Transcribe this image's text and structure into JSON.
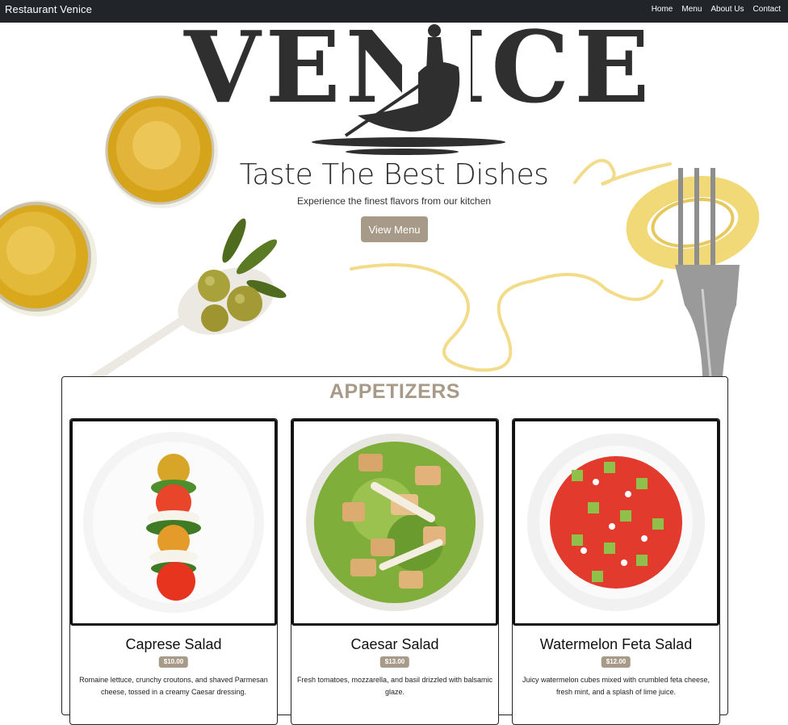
{
  "navbar": {
    "brand": "Restaurant Venice",
    "links": [
      "Home",
      "Menu",
      "About Us",
      "Contact"
    ]
  },
  "hero": {
    "logo_text": "VENICE",
    "title": "Taste The Best Dishes",
    "subtitle": "Experience the finest flavors from our kitchen",
    "button_label": "View Menu"
  },
  "section": {
    "title": "APPETIZERS",
    "items": [
      {
        "name": "Caprese Salad",
        "price": "$10.00",
        "description": "Romaine lettuce, crunchy croutons, and shaved Parmesan cheese, tossed in a creamy Caesar dressing."
      },
      {
        "name": "Caesar Salad",
        "price": "$13.00",
        "description": "Fresh tomatoes, mozzarella, and basil drizzled with balsamic glaze."
      },
      {
        "name": "Watermelon Feta Salad",
        "price": "$12.00",
        "description": "Juicy watermelon cubes mixed with crumbled feta cheese, fresh mint, and a splash of lime juice."
      }
    ]
  },
  "colors": {
    "navbar_bg": "#212529",
    "accent": "#a89a88",
    "logo": "#2f2f2f"
  }
}
